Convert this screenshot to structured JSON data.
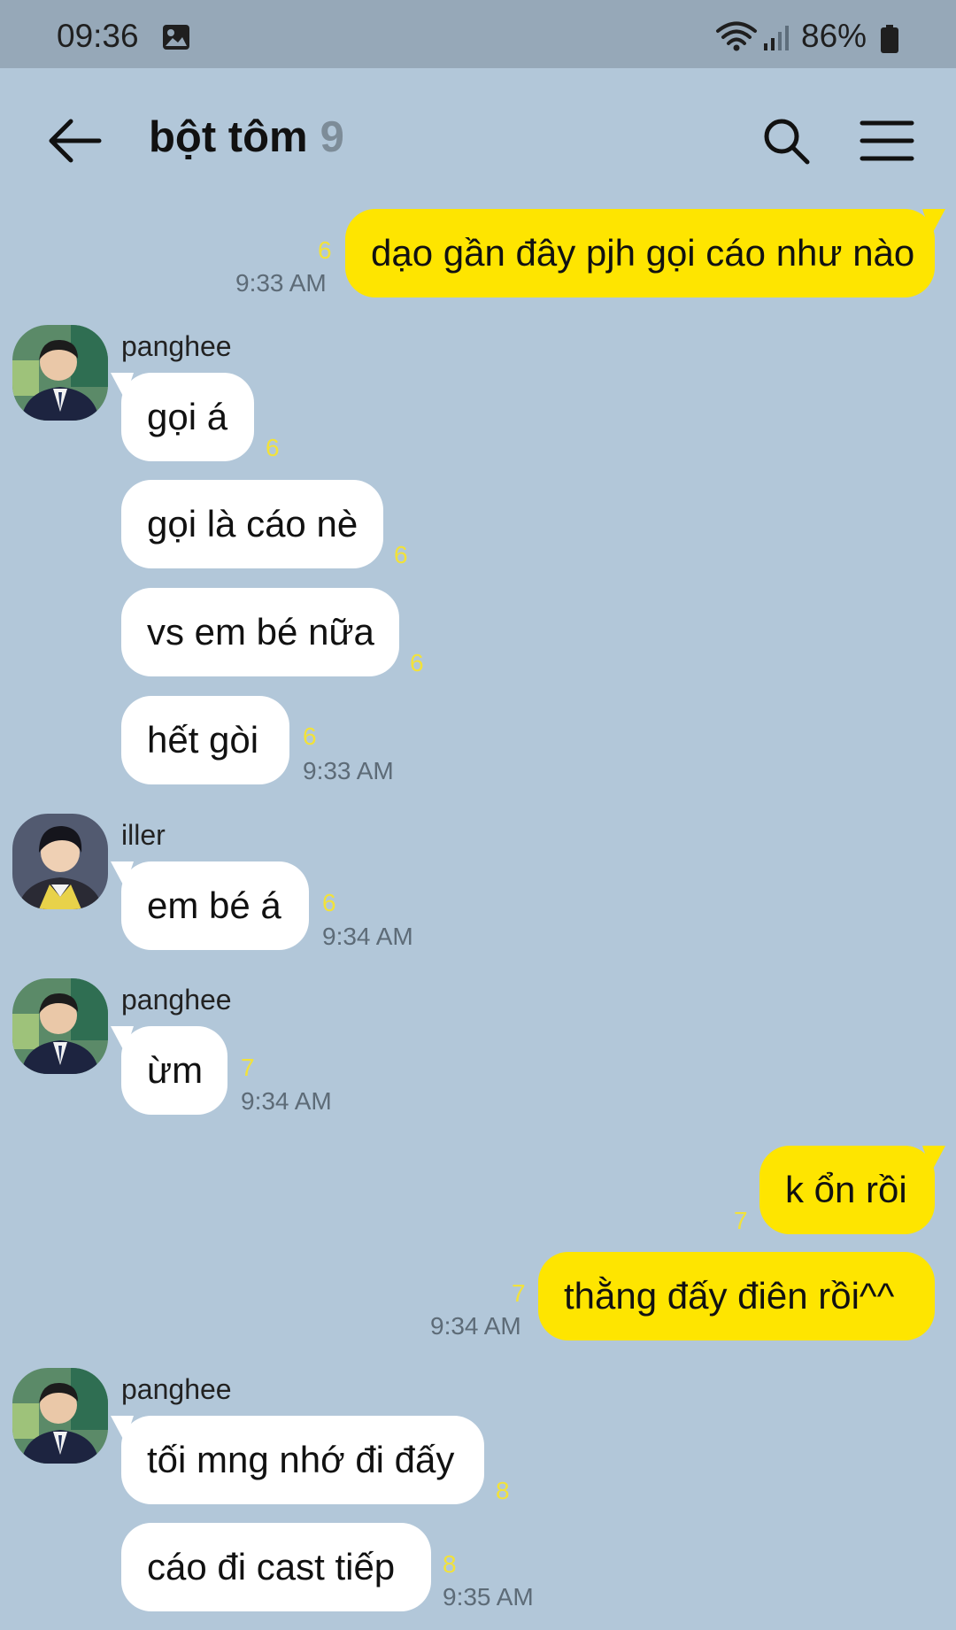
{
  "status_bar": {
    "time": "09:36",
    "battery": "86%"
  },
  "header": {
    "title": "bột tôm",
    "member_count": "9"
  },
  "messages": [
    {
      "type": "out",
      "text": "dạo gần đây pjh gọi cáo như nào",
      "unread": "6",
      "time": "9:33 AM"
    },
    {
      "type": "in",
      "sender": "panghee",
      "text": "gọi á",
      "unread": "6"
    },
    {
      "type": "in",
      "text": "gọi là cáo nè",
      "unread": "6"
    },
    {
      "type": "in",
      "text": "vs em bé nữa",
      "unread": "6"
    },
    {
      "type": "in",
      "text": "hết gòi",
      "unread": "6",
      "time": "9:33 AM"
    },
    {
      "type": "in",
      "sender": "iller",
      "text": "em bé á",
      "unread": "6",
      "time": "9:34 AM"
    },
    {
      "type": "in",
      "sender": "panghee",
      "text": "ừm",
      "unread": "7",
      "time": "9:34 AM"
    },
    {
      "type": "out",
      "text": "k ổn rồi",
      "unread": "7"
    },
    {
      "type": "out",
      "text": "thằng đấy điên rồi^^",
      "unread": "7",
      "time": "9:34 AM"
    },
    {
      "type": "in",
      "sender": "panghee",
      "text": "tối mng nhớ đi đấy",
      "unread": "8"
    },
    {
      "type": "in",
      "text": "cáo đi cast tiếp",
      "unread": "8",
      "time": "9:35 AM"
    }
  ],
  "colors": {
    "background": "#b2c7d9",
    "outgoing_bubble": "#fee500",
    "incoming_bubble": "#ffffff",
    "unread": "#f2e23a"
  },
  "icons": [
    "image-icon",
    "wifi-icon",
    "signal-icon",
    "battery-icon",
    "back-arrow-icon",
    "search-icon",
    "menu-icon"
  ]
}
